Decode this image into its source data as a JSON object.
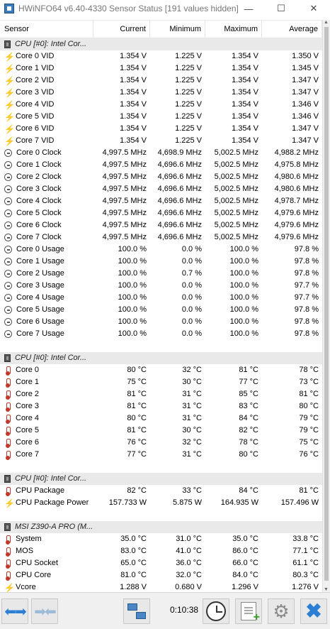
{
  "window": {
    "title": "HWiNFO64 v6.40-4330 Sensor Status [191 values hidden]",
    "controls": {
      "minimize": "—",
      "maximize": "☐",
      "close": "✕"
    }
  },
  "columns": [
    "Sensor",
    "Current",
    "Minimum",
    "Maximum",
    "Average"
  ],
  "rows": [
    {
      "t": "group",
      "label": "CPU [#0]: Intel Cor..."
    },
    {
      "t": "v",
      "name": "Core 0 VID",
      "cur": "1.354 V",
      "min": "1.225 V",
      "max": "1.354 V",
      "avg": "1.350 V"
    },
    {
      "t": "v",
      "name": "Core 1 VID",
      "cur": "1.354 V",
      "min": "1.225 V",
      "max": "1.354 V",
      "avg": "1.345 V"
    },
    {
      "t": "v",
      "name": "Core 2 VID",
      "cur": "1.354 V",
      "min": "1.225 V",
      "max": "1.354 V",
      "avg": "1.347 V"
    },
    {
      "t": "v",
      "name": "Core 3 VID",
      "cur": "1.354 V",
      "min": "1.225 V",
      "max": "1.354 V",
      "avg": "1.347 V"
    },
    {
      "t": "v",
      "name": "Core 4 VID",
      "cur": "1.354 V",
      "min": "1.225 V",
      "max": "1.354 V",
      "avg": "1.346 V"
    },
    {
      "t": "v",
      "name": "Core 5 VID",
      "cur": "1.354 V",
      "min": "1.225 V",
      "max": "1.354 V",
      "avg": "1.346 V"
    },
    {
      "t": "v",
      "name": "Core 6 VID",
      "cur": "1.354 V",
      "min": "1.225 V",
      "max": "1.354 V",
      "avg": "1.347 V"
    },
    {
      "t": "v",
      "name": "Core 7 VID",
      "cur": "1.354 V",
      "min": "1.225 V",
      "max": "1.354 V",
      "avg": "1.347 V"
    },
    {
      "t": "c",
      "name": "Core 0 Clock",
      "cur": "4,997.5 MHz",
      "min": "4,698.9 MHz",
      "max": "5,002.5 MHz",
      "avg": "4,988.2 MHz"
    },
    {
      "t": "c",
      "name": "Core 1 Clock",
      "cur": "4,997.5 MHz",
      "min": "4,696.6 MHz",
      "max": "5,002.5 MHz",
      "avg": "4,975.8 MHz"
    },
    {
      "t": "c",
      "name": "Core 2 Clock",
      "cur": "4,997.5 MHz",
      "min": "4,696.6 MHz",
      "max": "5,002.5 MHz",
      "avg": "4,980.6 MHz"
    },
    {
      "t": "c",
      "name": "Core 3 Clock",
      "cur": "4,997.5 MHz",
      "min": "4,696.6 MHz",
      "max": "5,002.5 MHz",
      "avg": "4,980.6 MHz"
    },
    {
      "t": "c",
      "name": "Core 4 Clock",
      "cur": "4,997.5 MHz",
      "min": "4,696.6 MHz",
      "max": "5,002.5 MHz",
      "avg": "4,978.7 MHz"
    },
    {
      "t": "c",
      "name": "Core 5 Clock",
      "cur": "4,997.5 MHz",
      "min": "4,696.6 MHz",
      "max": "5,002.5 MHz",
      "avg": "4,979.6 MHz"
    },
    {
      "t": "c",
      "name": "Core 6 Clock",
      "cur": "4,997.5 MHz",
      "min": "4,696.6 MHz",
      "max": "5,002.5 MHz",
      "avg": "4,979.6 MHz"
    },
    {
      "t": "c",
      "name": "Core 7 Clock",
      "cur": "4,997.5 MHz",
      "min": "4,696.6 MHz",
      "max": "5,002.5 MHz",
      "avg": "4,979.6 MHz"
    },
    {
      "t": "c",
      "name": "Core 0 Usage",
      "cur": "100.0 %",
      "min": "0.0 %",
      "max": "100.0 %",
      "avg": "97.8 %"
    },
    {
      "t": "c",
      "name": "Core 1 Usage",
      "cur": "100.0 %",
      "min": "0.0 %",
      "max": "100.0 %",
      "avg": "97.8 %"
    },
    {
      "t": "c",
      "name": "Core 2 Usage",
      "cur": "100.0 %",
      "min": "0.7 %",
      "max": "100.0 %",
      "avg": "97.8 %"
    },
    {
      "t": "c",
      "name": "Core 3 Usage",
      "cur": "100.0 %",
      "min": "0.0 %",
      "max": "100.0 %",
      "avg": "97.7 %"
    },
    {
      "t": "c",
      "name": "Core 4 Usage",
      "cur": "100.0 %",
      "min": "0.0 %",
      "max": "100.0 %",
      "avg": "97.7 %"
    },
    {
      "t": "c",
      "name": "Core 5 Usage",
      "cur": "100.0 %",
      "min": "0.0 %",
      "max": "100.0 %",
      "avg": "97.8 %"
    },
    {
      "t": "c",
      "name": "Core 6 Usage",
      "cur": "100.0 %",
      "min": "0.0 %",
      "max": "100.0 %",
      "avg": "97.8 %"
    },
    {
      "t": "c",
      "name": "Core 7 Usage",
      "cur": "100.0 %",
      "min": "0.0 %",
      "max": "100.0 %",
      "avg": "97.8 %"
    },
    {
      "t": "blank"
    },
    {
      "t": "group",
      "label": "CPU [#0]: Intel Cor..."
    },
    {
      "t": "th",
      "name": "Core 0",
      "cur": "80 °C",
      "min": "32 °C",
      "max": "81 °C",
      "avg": "78 °C"
    },
    {
      "t": "th",
      "name": "Core 1",
      "cur": "75 °C",
      "min": "30 °C",
      "max": "77 °C",
      "avg": "73 °C"
    },
    {
      "t": "th",
      "name": "Core 2",
      "cur": "81 °C",
      "min": "31 °C",
      "max": "85 °C",
      "avg": "81 °C"
    },
    {
      "t": "th",
      "name": "Core 3",
      "cur": "81 °C",
      "min": "31 °C",
      "max": "83 °C",
      "avg": "80 °C"
    },
    {
      "t": "th",
      "name": "Core 4",
      "cur": "80 °C",
      "min": "31 °C",
      "max": "84 °C",
      "avg": "79 °C"
    },
    {
      "t": "th",
      "name": "Core 5",
      "cur": "81 °C",
      "min": "30 °C",
      "max": "82 °C",
      "avg": "79 °C"
    },
    {
      "t": "th",
      "name": "Core 6",
      "cur": "76 °C",
      "min": "32 °C",
      "max": "78 °C",
      "avg": "75 °C"
    },
    {
      "t": "th",
      "name": "Core 7",
      "cur": "77 °C",
      "min": "31 °C",
      "max": "80 °C",
      "avg": "76 °C"
    },
    {
      "t": "blank"
    },
    {
      "t": "group",
      "label": "CPU [#0]: Intel Cor..."
    },
    {
      "t": "th",
      "name": "CPU Package",
      "cur": "82 °C",
      "min": "33 °C",
      "max": "84 °C",
      "avg": "81 °C"
    },
    {
      "t": "v",
      "name": "CPU Package Power",
      "cur": "157.733 W",
      "min": "5.875 W",
      "max": "164.935 W",
      "avg": "157.496 W"
    },
    {
      "t": "blank"
    },
    {
      "t": "group",
      "label": "MSI Z390-A PRO (M..."
    },
    {
      "t": "th",
      "name": "System",
      "cur": "35.0 °C",
      "min": "31.0 °C",
      "max": "35.0 °C",
      "avg": "33.8 °C"
    },
    {
      "t": "th",
      "name": "MOS",
      "cur": "83.0 °C",
      "min": "41.0 °C",
      "max": "86.0 °C",
      "avg": "77.1 °C"
    },
    {
      "t": "th",
      "name": "CPU Socket",
      "cur": "65.0 °C",
      "min": "36.0 °C",
      "max": "66.0 °C",
      "avg": "61.1 °C"
    },
    {
      "t": "th",
      "name": "CPU Core",
      "cur": "81.0 °C",
      "min": "32.0 °C",
      "max": "84.0 °C",
      "avg": "80.3 °C"
    },
    {
      "t": "v",
      "name": "Vcore",
      "cur": "1.288 V",
      "min": "0.680 V",
      "max": "1.296 V",
      "avg": "1.276 V"
    }
  ],
  "toolbar": {
    "elapsed": "0:10:38"
  },
  "icons": {
    "v": "bolt-icon",
    "c": "clock-icon",
    "th": "thermometer-icon",
    "group": "chip-icon"
  },
  "colors": {
    "group_bg": "#e9e9e9",
    "accent": "#2d7fd3",
    "bolt": "#e6b800",
    "therm": "#c0392b"
  }
}
